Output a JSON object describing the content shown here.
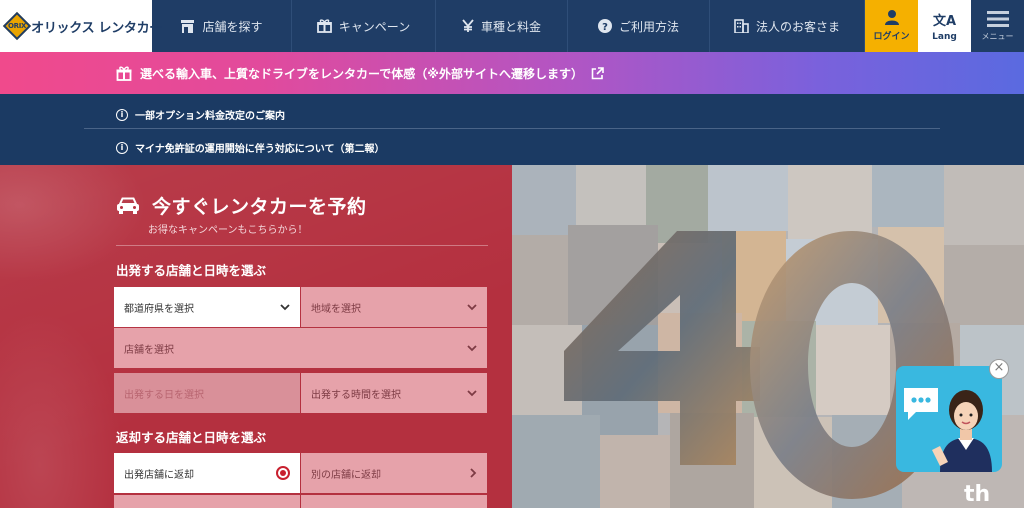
{
  "header": {
    "logo_mark": "ORIX",
    "logo_text": "オリックス レンタカー",
    "nav": [
      {
        "label": "店舗を探す",
        "icon": "store-icon"
      },
      {
        "label": "キャンペーン",
        "icon": "gift-icon"
      },
      {
        "label": "車種と料金",
        "icon": "yen-icon"
      },
      {
        "label": "ご利用方法",
        "icon": "question-icon"
      },
      {
        "label": "法人のお客さま",
        "icon": "building-icon"
      }
    ],
    "login_label": "ログイン",
    "lang_label": "Lang",
    "lang_glyph": "文A",
    "menu_label": "メニュー"
  },
  "promo": {
    "text": "選べる輸入車、上質なドライブをレンタカーで体感（※外部サイトへ遷移します）"
  },
  "notices": [
    {
      "text": "一部オプション料金改定のご案内"
    },
    {
      "text": "マイナ免許証の運用開始に伴う対応について（第二報）"
    }
  ],
  "booking": {
    "title": "今すぐレンタカーを予約",
    "subtitle": "お得なキャンペーンもこちらから！",
    "departure_title": "出発する店舗と日時を選ぶ",
    "prefecture_placeholder": "都道府県を選択",
    "area_placeholder": "地域を選択",
    "store_placeholder": "店舗を選択",
    "date_placeholder": "出発する日を選択",
    "time_placeholder": "出発する時間を選択",
    "return_title": "返却する店舗と日時を選ぶ",
    "return_same": "出発店舗に返却",
    "return_other": "別の店舗に返却"
  },
  "collage": {
    "badge_number": "40",
    "badge_suffix": "th"
  },
  "chat": {
    "close_glyph": "×"
  },
  "colors": {
    "navy": "#1f3d66",
    "accent_yellow": "#f5b000",
    "booking_red": "#b4303f",
    "chat_blue": "#39b8e0"
  }
}
